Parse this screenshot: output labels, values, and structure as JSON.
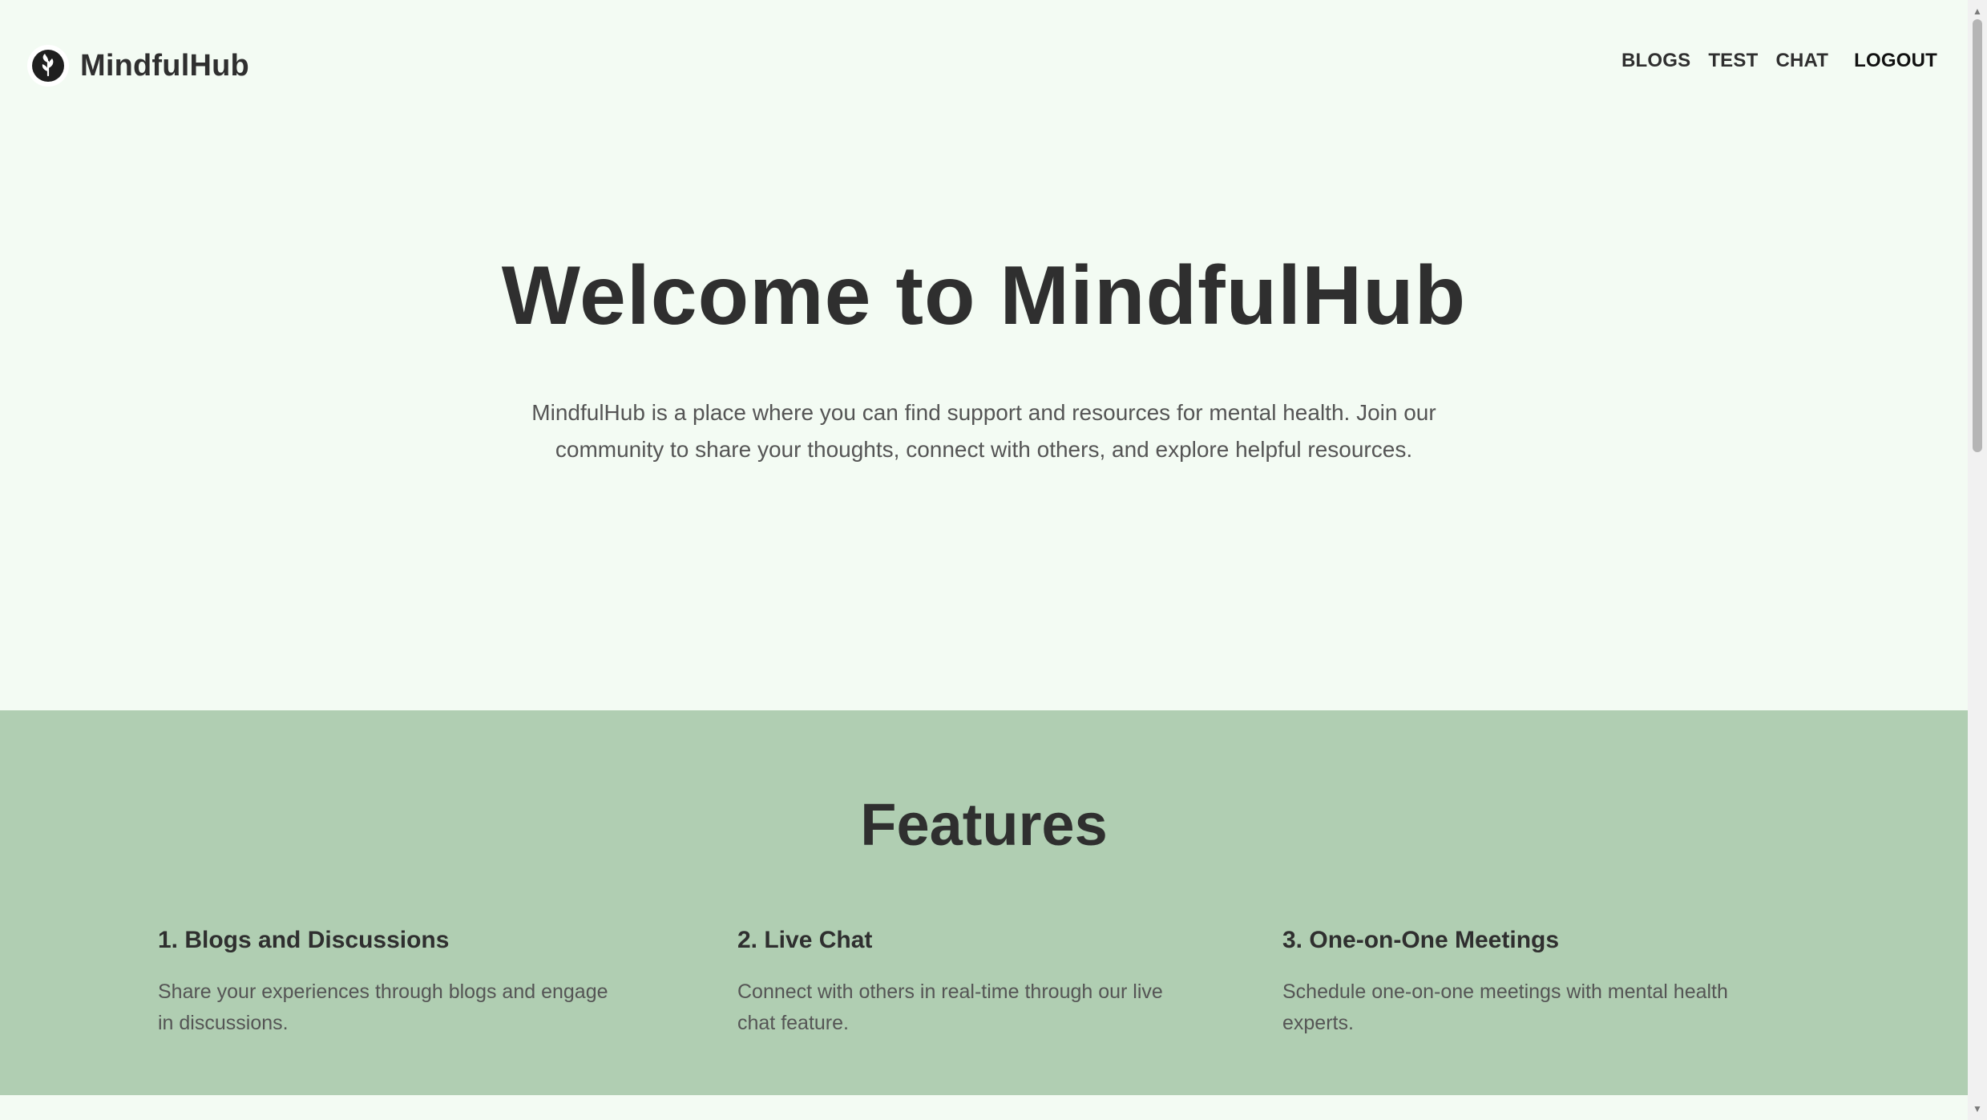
{
  "brand": {
    "name": "MindfulHub",
    "logo_icon": "leaf-logo-icon"
  },
  "nav": {
    "blogs": "BLOGS",
    "test": "TEST",
    "chat": "CHAT",
    "logout": "LOGOUT"
  },
  "hero": {
    "title": "Welcome to MindfulHub",
    "description": "MindfulHub is a place where you can find support and resources for mental health. Join our community to share your thoughts, connect with others, and explore helpful resources."
  },
  "features": {
    "title": "Features",
    "items": [
      {
        "title": "1. Blogs and Discussions",
        "description": "Share your experiences through blogs and engage in discussions."
      },
      {
        "title": "2. Live Chat",
        "description": "Connect with others in real-time through our live chat feature."
      },
      {
        "title": "3. One-on-One Meetings",
        "description": "Schedule one-on-one meetings with mental health experts."
      }
    ]
  },
  "colors": {
    "page_background": "#f3fbf3",
    "features_background": "#b0ceb2",
    "heading_text": "#2f2f2f",
    "body_text": "#555555"
  }
}
